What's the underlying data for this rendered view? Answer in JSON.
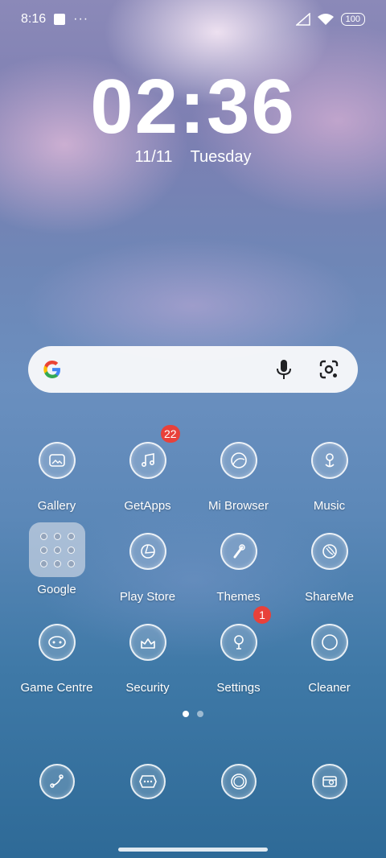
{
  "status_bar": {
    "time": "8:16",
    "overflow": "···",
    "battery": "100",
    "icons": [
      "notification-square-icon",
      "signal-icon",
      "wifi-icon",
      "battery-icon"
    ]
  },
  "clock": {
    "time": "02:36",
    "date": "11/11",
    "weekday": "Tuesday"
  },
  "search_bar": {
    "icons": [
      "google-logo-icon",
      "microphone-icon",
      "lens-camera-icon"
    ]
  },
  "apps": {
    "row1": [
      {
        "label": "Gallery",
        "icon": "gallery-icon"
      },
      {
        "label": "GetApps",
        "icon": "music-note-icon",
        "badge": "22"
      },
      {
        "label": "Mi Browser",
        "icon": "browser-icon"
      },
      {
        "label": "Music",
        "icon": "music-icon"
      }
    ],
    "row2": [
      {
        "label": "Google",
        "icon": "folder-icon"
      },
      {
        "label": "Play Store",
        "icon": "play-store-icon"
      },
      {
        "label": "Themes",
        "icon": "themes-icon"
      },
      {
        "label": "ShareMe",
        "icon": "shareme-icon"
      }
    ],
    "row3": [
      {
        "label": "Game Centre",
        "icon": "gamepad-icon"
      },
      {
        "label": "Security",
        "icon": "security-icon"
      },
      {
        "label": "Settings",
        "icon": "settings-icon",
        "badge": "1"
      },
      {
        "label": "Cleaner",
        "icon": "cleaner-icon"
      }
    ]
  },
  "page_indicator": {
    "pages": 2,
    "current": 1
  },
  "dock": [
    "phone-icon",
    "messages-icon",
    "camera-icon",
    "app-store-icon"
  ],
  "colors": {
    "badge": "#e8413a",
    "search_bg": "#f8f8fa"
  }
}
